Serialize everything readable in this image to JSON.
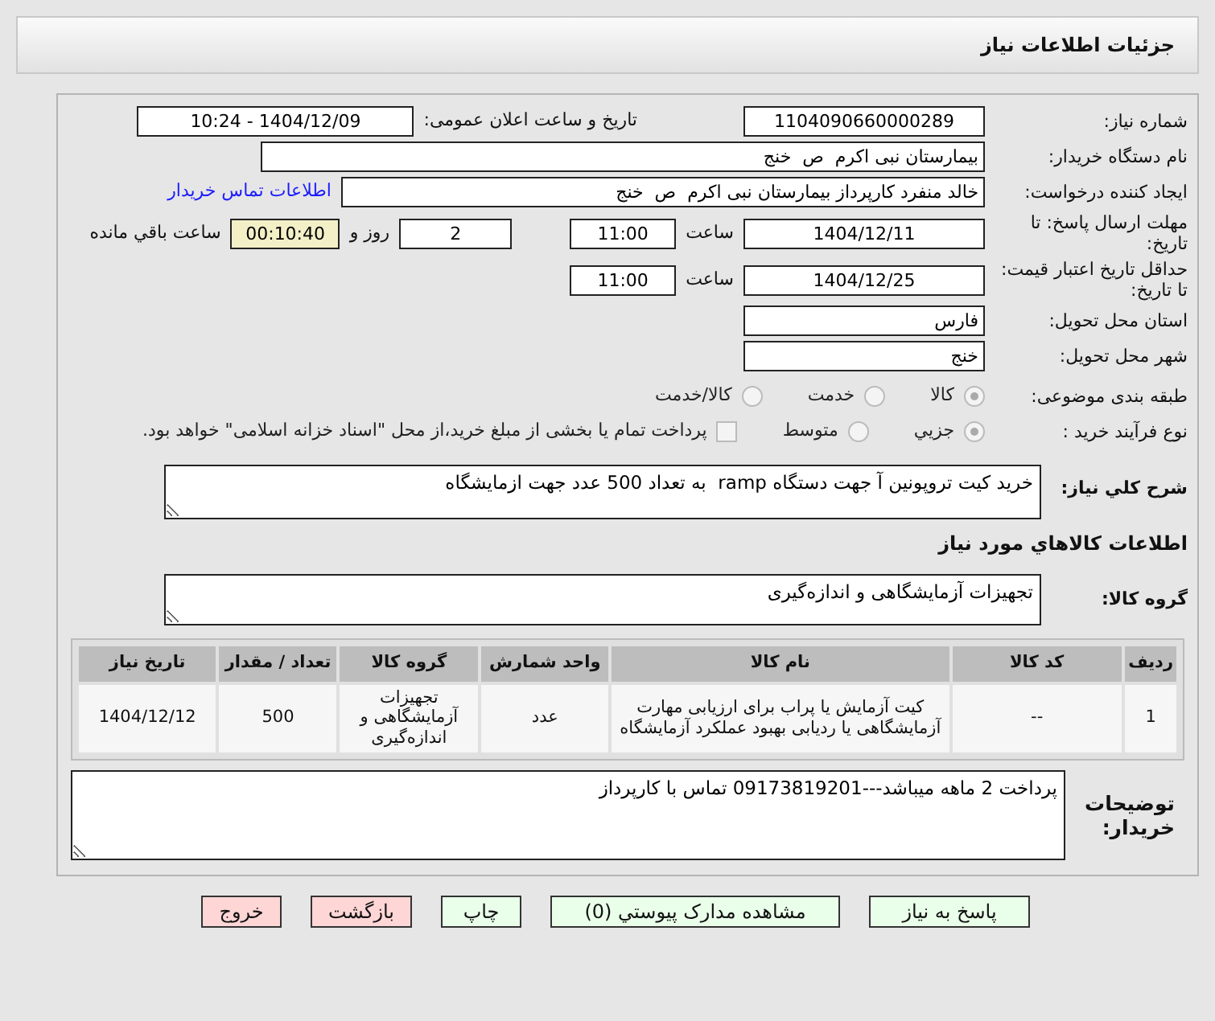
{
  "title": "جزئیات اطلاعات نیاز",
  "need_number": {
    "label": "شماره نیاز:",
    "value": "1104090660000289"
  },
  "announce_datetime": {
    "label": "تاریخ و ساعت اعلان عمومی:",
    "value": "1404/12/09 - 10:24"
  },
  "buyer_org": {
    "label": "نام دستگاه خریدار:",
    "value": "بیمارستان نبی اکرم  ص  خنج"
  },
  "requester": {
    "label": "ایجاد کننده درخواست:",
    "value": "خالد منفرد کارپرداز بیمارستان نبی اکرم  ص  خنج",
    "link": "اطلاعات تماس خریدار"
  },
  "reply_deadline": {
    "label": "مهلت ارسال پاسخ: تا تاریخ:",
    "date": "1404/12/11",
    "time_label": "ساعت",
    "time": "11:00",
    "days": "2",
    "days_label": "روز و",
    "remaining": "00:10:40",
    "remaining_label": "ساعت باقي مانده"
  },
  "price_validity": {
    "label": "حداقل تاریخ اعتبار قیمت: تا تاریخ:",
    "date": "1404/12/25",
    "time_label": "ساعت",
    "time": "11:00"
  },
  "province": {
    "label": "استان محل تحویل:",
    "value": "فارس"
  },
  "city": {
    "label": "شهر محل تحویل:",
    "value": "خنج"
  },
  "category": {
    "label": "طبقه بندی موضوعی:",
    "options": [
      {
        "label": "کالا",
        "selected": true
      },
      {
        "label": "خدمت",
        "selected": false
      },
      {
        "label": "کالا/خدمت",
        "selected": false
      }
    ]
  },
  "process": {
    "label": "نوع فرآیند خرید :",
    "options": [
      {
        "label": "جزیي",
        "selected": true
      },
      {
        "label": "متوسط",
        "selected": false
      }
    ],
    "payment": {
      "label": "پرداخت تمام یا بخشی از مبلغ خرید،از محل \"اسناد خزانه اسلامی\" خواهد بود.",
      "checked": false
    }
  },
  "description": {
    "label": "شرح کلي نیاز:",
    "value": "خرید کیت تروپونین آ جهت دستگاه ramp  به تعداد 500 عدد جهت ازمایشگاه"
  },
  "goods_heading": "اطلاعات کالاهاي مورد نیاز",
  "goods_group": {
    "label": "گروه کالا:",
    "value": "تجهیزات آزمایشگاهی و اندازه‌گیری"
  },
  "table": {
    "columns": [
      "ردیف",
      "کد کالا",
      "نام کالا",
      "واحد شمارش",
      "گروه کالا",
      "تعداد / مقدار",
      "تاریخ نیاز"
    ],
    "rows": [
      [
        "1",
        "--",
        "کیت آزمایش یا پراب برای ارزیابی مهارت آزمایشگاهی یا ردیابی بهبود عملکرد آزمایشگاه",
        "عدد",
        "تجهیزات آزمایشگاهی و اندازه‌گیری",
        "500",
        "1404/12/12"
      ]
    ]
  },
  "buyer_notes": {
    "label": "توضیحات خریدار:",
    "value": "پرداخت 2 ماهه میباشد---09173819201 تماس با کارپرداز"
  },
  "buttons": [
    {
      "label": "پاسخ به نیاز",
      "kind": "action"
    },
    {
      "label": "مشاهده مدارک پیوستي (0)",
      "kind": "action"
    },
    {
      "label": "چاپ",
      "kind": "action"
    },
    {
      "label": "بازگشت",
      "kind": "cancel"
    },
    {
      "label": "خروج",
      "kind": "cancel"
    }
  ]
}
